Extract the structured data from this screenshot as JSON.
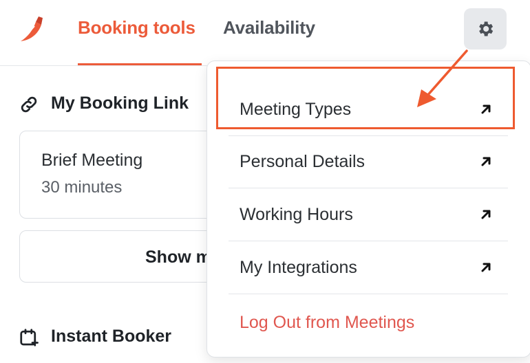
{
  "header": {
    "tabs": [
      {
        "label": "Booking tools",
        "active": true
      },
      {
        "label": "Availability",
        "active": false
      }
    ],
    "settings_icon": "gear-icon",
    "logo_icon": "chili-pepper-logo"
  },
  "sidebar": {
    "booking_link": {
      "title": "My Booking Link",
      "icon": "link-icon"
    },
    "meeting_card": {
      "name": "Brief Meeting",
      "duration": "30 minutes"
    },
    "show_more_label": "Show m",
    "instant_booker": {
      "title": "Instant Booker",
      "icon": "calendar-plus-icon"
    }
  },
  "settings_menu": {
    "items": [
      {
        "label": "Meeting Types",
        "icon": "arrow-up-right-icon",
        "highlighted": true
      },
      {
        "label": "Personal Details",
        "icon": "arrow-up-right-icon"
      },
      {
        "label": "Working Hours",
        "icon": "arrow-up-right-icon"
      },
      {
        "label": "My Integrations",
        "icon": "arrow-up-right-icon"
      }
    ],
    "logout_label": "Log Out from Meetings"
  },
  "colors": {
    "accent": "#ec5b3a",
    "logout": "#e0574f",
    "annotation": "#ee5a2f"
  }
}
